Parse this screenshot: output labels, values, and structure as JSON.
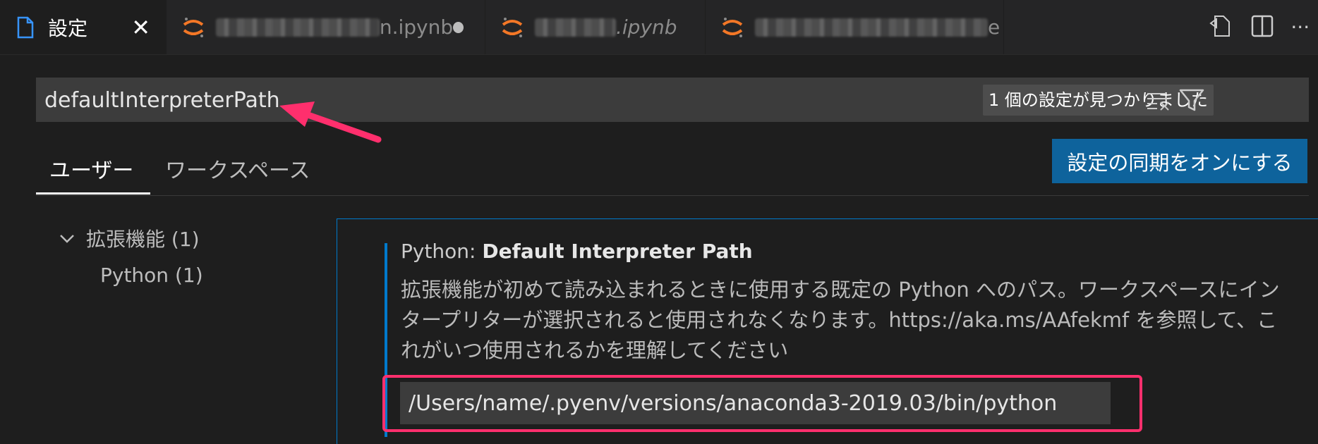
{
  "tabs": [
    {
      "label": "設定",
      "type": "settings",
      "active": true
    },
    {
      "label_suffix": "n.ipynb",
      "type": "notebook",
      "dirty": true
    },
    {
      "label_suffix": ".ipynb",
      "type": "notebook",
      "italic": true
    },
    {
      "label_suffix": "e",
      "type": "notebook"
    }
  ],
  "search": {
    "value": "defaultInterpreterPath",
    "result_count": "1 個の設定が見つかりました"
  },
  "scopes": {
    "user": "ユーザー",
    "workspace": "ワークスペース"
  },
  "sync_button": "設定の同期をオンにする",
  "toc": {
    "group": "拡張機能 (1)",
    "child": "Python (1)"
  },
  "setting": {
    "category": "Python:",
    "name": "Default Interpreter Path",
    "description": "拡張機能が初めて読み込まれるときに使用する既定の Python へのパス。ワークスペースにインタープリターが選択されると使用されなくなります。https://aka.ms/AAfekmf を参照して、これがいつ使用されるかを理解してください",
    "value": "/Users/name/.pyenv/versions/anaconda3-2019.03/bin/python"
  },
  "colors": {
    "accent": "#007acc",
    "button": "#0e639c",
    "annotation": "#ff2f6d",
    "jupyter_orange": "#f37726"
  }
}
